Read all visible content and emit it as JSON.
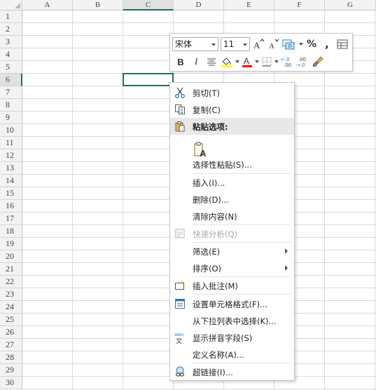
{
  "columns": [
    "A",
    "B",
    "C",
    "D",
    "E",
    "F",
    "G"
  ],
  "rows": [
    "1",
    "2",
    "3",
    "4",
    "5",
    "6",
    "7",
    "8",
    "9",
    "10",
    "11",
    "12",
    "13",
    "14",
    "15",
    "16",
    "17",
    "18",
    "19",
    "20",
    "21",
    "22",
    "23",
    "24",
    "25",
    "26",
    "27",
    "28",
    "29",
    "30"
  ],
  "selected_column": "C",
  "selected_row": "6",
  "mini_toolbar": {
    "font_name": "宋体",
    "font_size": "11",
    "bold": "B",
    "italic": "I",
    "percent": "%",
    "comma": ",",
    "font_color": "#ff0000",
    "fill_color": "#ffff00"
  },
  "context_menu": {
    "cut": "剪切(T)",
    "copy": "复制(C)",
    "paste_options": "粘贴选项:",
    "paste_special": "选择性粘贴(S)...",
    "insert": "插入(I)...",
    "delete": "删除(D)...",
    "clear_contents": "清除内容(N)",
    "quick_analysis": "快速分析(Q)",
    "filter": "筛选(E)",
    "sort": "排序(O)",
    "insert_comment": "插入批注(M)",
    "format_cells": "设置单元格格式(F)...",
    "pick_from_list": "从下拉列表中选择(K)...",
    "show_phonetic": "显示拼音字段(S)",
    "define_name": "定义名称(A)...",
    "hyperlink": "超链接(I)..."
  },
  "colors": {
    "accent": "#217346",
    "header_bg": "#f3f3f3",
    "grid": "#dadada"
  }
}
